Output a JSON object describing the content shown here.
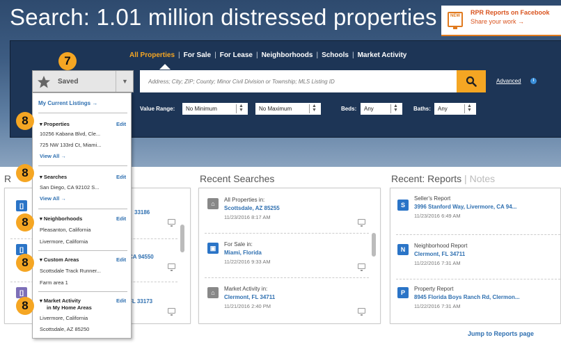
{
  "header": {
    "title": "Search: 1.01 million distressed properties",
    "fb_badge": "NEW",
    "fb_title": "RPR Reports on Facebook",
    "fb_share": "Share your work →"
  },
  "tabs": [
    "All Properties",
    "For Sale",
    "For Lease",
    "Neighborhoods",
    "Schools",
    "Market Activity"
  ],
  "search": {
    "placeholder": "Address; City; ZIP; County; Minor Civil Division or Township; MLS Listing ID",
    "advanced": "Advanced",
    "info": "i"
  },
  "filters": {
    "value_range_label": "Value Range:",
    "min": "No Minimum",
    "max": "No Maximum",
    "beds_label": "Beds:",
    "beds": "Any",
    "baths_label": "Baths:",
    "baths": "Any"
  },
  "saved": {
    "label": "Saved",
    "my_listings": "My Current Listings →",
    "sections": [
      {
        "title": "Properties",
        "edit": "Edit",
        "items": [
          "10256 Kabana Blvd, Cle...",
          "725 NW 133rd Ct, Miami..."
        ],
        "view_all": "View All →"
      },
      {
        "title": "Searches",
        "edit": "Edit",
        "items": [
          "San Diego, CA 92102 S..."
        ],
        "view_all": "View All →"
      },
      {
        "title": "Neighborhoods",
        "edit": "Edit",
        "items": [
          "Pleasanton, California",
          "Livermore, California"
        ]
      },
      {
        "title": "Custom Areas",
        "edit": "Edit",
        "items": [
          "Scottsdale Track Runner...",
          "Farm area 1"
        ]
      },
      {
        "title": "Market Activity",
        "title2": "in My Home Areas",
        "edit": "Edit",
        "items": [
          "Livermore, California",
          "Scottsdale, AZ 85250"
        ]
      }
    ]
  },
  "badges": {
    "saved": "7",
    "sections": "8"
  },
  "recent_properties": {
    "heading_letter": "R",
    "zips": [
      "33186",
      "CA 94550",
      "FL 33173"
    ]
  },
  "recent_searches": {
    "heading": "Recent Searches",
    "items": [
      {
        "line1": "All Properties in:",
        "line2": "Scottsdale, AZ 85255",
        "line3": "11/23/2016 8:17 AM"
      },
      {
        "line1": "For Sale in:",
        "line2": "Miami, Florida",
        "line3": "11/22/2016 9:33 AM"
      },
      {
        "line1": "Market Activity in:",
        "line2": "Clermont, FL 34711",
        "line3": "11/21/2016 2:40 PM"
      }
    ]
  },
  "recent_reports": {
    "heading": "Recent: Reports",
    "tab_notes": "Notes",
    "items": [
      {
        "icon": "S",
        "line1": "Seller's Report",
        "line2": "3996 Stanford Way, Livermore, CA 94...",
        "line3": "11/23/2016 6:49 AM"
      },
      {
        "icon": "N",
        "line1": "Neighborhood Report",
        "line2": "Clermont, FL 34711",
        "line3": "11/22/2016 7:31 AM"
      },
      {
        "icon": "P",
        "line1": "Property Report",
        "line2": "8945 Florida Boys Ranch Rd, Clermon...",
        "line3": "11/22/2016 7:31 AM"
      }
    ],
    "jump": "Jump to Reports page"
  },
  "colors": {
    "accent": "#f5a623",
    "panel": "#1d3556",
    "link": "#2e6fb0",
    "facebook_orange": "#d9531e"
  }
}
